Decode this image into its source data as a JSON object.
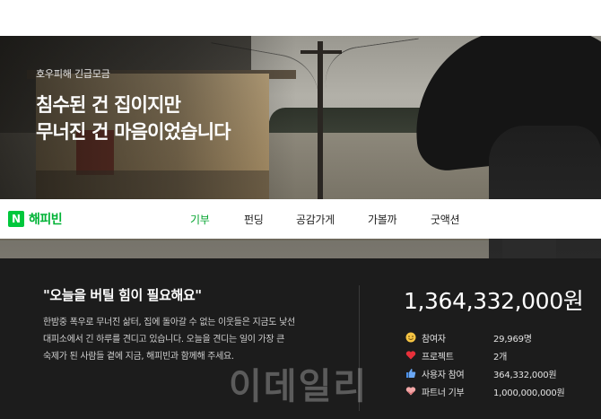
{
  "hero": {
    "subtitle": "호우피해 긴급모금",
    "title_line1": "침수된 건 집이지만",
    "title_line2": "무너진 건 마음이었습니다"
  },
  "brand": {
    "logo_letter": "N",
    "name": "해피빈",
    "accent_color": "#00c73c"
  },
  "nav": {
    "items": [
      {
        "label": "기부",
        "active": true
      },
      {
        "label": "펀딩",
        "active": false
      },
      {
        "label": "공감가게",
        "active": false
      },
      {
        "label": "가볼까",
        "active": false
      },
      {
        "label": "굿액션",
        "active": false
      }
    ]
  },
  "campaign": {
    "quote": "\"오늘을 버틸 힘이 필요해요\"",
    "description_line1": "한밤중 폭우로 무너진 삶터, 집에 돌아갈 수 없는 이웃들은 지금도 낯선",
    "description_line2": "대피소에서 긴 하루를 견디고 있습니다. 오늘을 견디는 일이 가장 큰",
    "description_line3": "숙제가 된 사람들 곁에 지금, 해피빈과 함께해 주세요.",
    "total_amount": "1,364,332,000원"
  },
  "stats": [
    {
      "icon": "smile-icon",
      "label": "참여자",
      "value": "29,969명"
    },
    {
      "icon": "heart-icon",
      "label": "프로젝트",
      "value": "2개"
    },
    {
      "icon": "thumbs-up-icon",
      "label": "사용자 참여",
      "value": "364,332,000원"
    },
    {
      "icon": "partner-heart-icon",
      "label": "파트너 기부",
      "value": "1,000,000,000원"
    }
  ],
  "watermark": "이데일리"
}
